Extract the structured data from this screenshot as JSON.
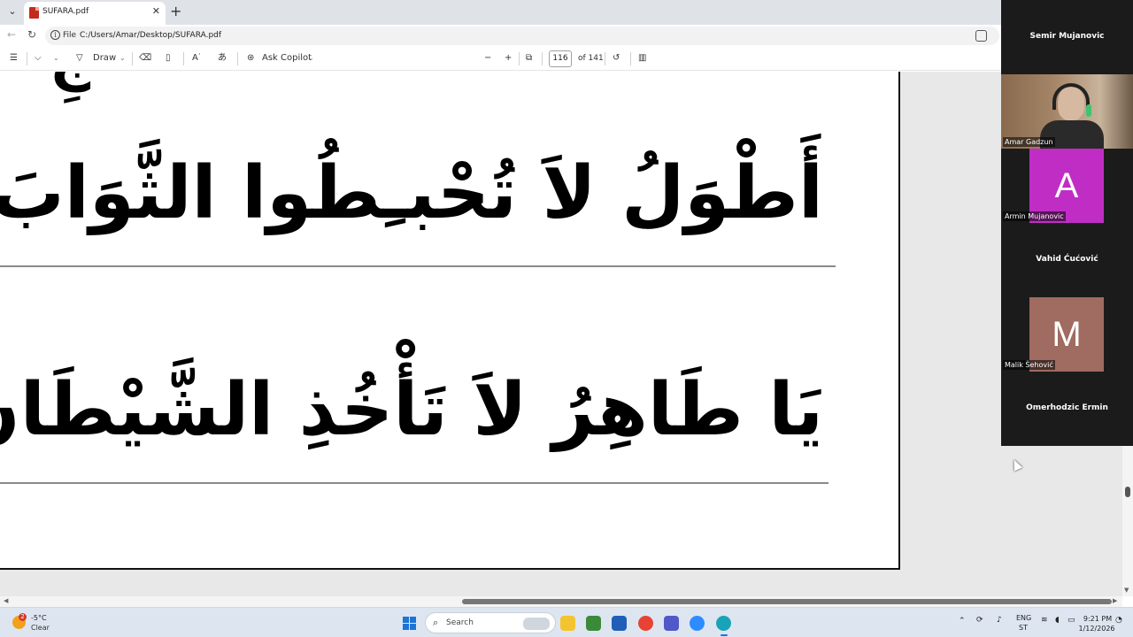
{
  "browser": {
    "tab": {
      "title": "SUFARA.pdf"
    },
    "address": {
      "file_label": "File",
      "url": "C:/Users/Amar/Desktop/SUFARA.pdf"
    }
  },
  "pdf_toolbar": {
    "draw_label": "Draw",
    "copilot_label": "Ask Copilot",
    "page_current": "116",
    "page_total": "of 141"
  },
  "document": {
    "line1": "أَطْوَلُ  لاَ  تُحْبـِطُوا  الثَّوَابَ",
    "line2": "يَا  طَاهِرُ  لاَ  تَأْخُذِ  الشَّيْطَانَ",
    "line_top_fragment": "جِ"
  },
  "participants": [
    {
      "name": "Semir Mujanovic",
      "kind": "name-only"
    },
    {
      "name": "Amar Gadzun",
      "kind": "video"
    },
    {
      "name": "Armin Mujanovic",
      "kind": "avatar",
      "initial": "A",
      "color": "#c02dc5"
    },
    {
      "name": "Vahid Ćućović",
      "kind": "name-only"
    },
    {
      "name": "Malik Šehović",
      "kind": "avatar",
      "initial": "M",
      "color": "#a06b60"
    },
    {
      "name": "Omerhodzic Ermin",
      "kind": "name-only"
    }
  ],
  "taskbar": {
    "weather": {
      "temp": "-5°C",
      "condition": "Clear",
      "badge": "2"
    },
    "search_label": "Search",
    "tray": {
      "lang_line1": "ENG",
      "lang_line2": "ST"
    },
    "clock": {
      "time": "9:21 PM",
      "date": "1/12/2026"
    }
  }
}
